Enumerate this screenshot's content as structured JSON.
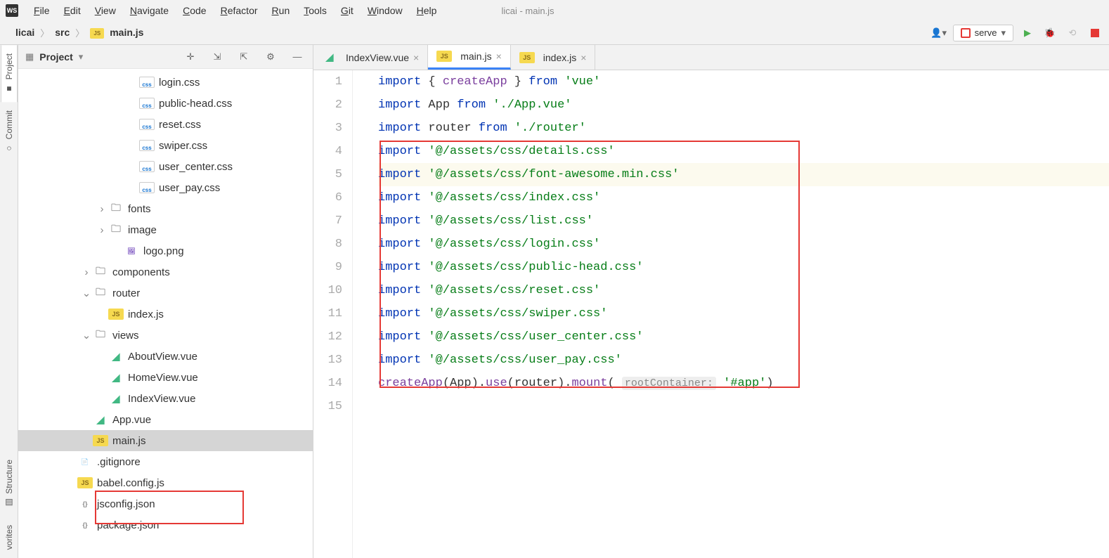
{
  "menubar": {
    "items": [
      "File",
      "Edit",
      "View",
      "Navigate",
      "Code",
      "Refactor",
      "Run",
      "Tools",
      "Git",
      "Window",
      "Help"
    ]
  },
  "window_title": "licai - main.js",
  "breadcrumbs": [
    "licai",
    "src",
    "main.js"
  ],
  "toolbar": {
    "run_config": "serve"
  },
  "left_rail": [
    "Project",
    "Commit",
    "Structure",
    "vorites"
  ],
  "project_label": "Project",
  "tree": [
    {
      "indent": 7,
      "type": "css",
      "name": "login.css"
    },
    {
      "indent": 7,
      "type": "css",
      "name": "public-head.css"
    },
    {
      "indent": 7,
      "type": "css",
      "name": "reset.css"
    },
    {
      "indent": 7,
      "type": "css",
      "name": "swiper.css"
    },
    {
      "indent": 7,
      "type": "css",
      "name": "user_center.css"
    },
    {
      "indent": 7,
      "type": "css",
      "name": "user_pay.css"
    },
    {
      "indent": 5,
      "chev": ">",
      "type": "folder",
      "name": "fonts"
    },
    {
      "indent": 5,
      "chev": ">",
      "type": "folder",
      "name": "image"
    },
    {
      "indent": 6,
      "type": "img",
      "name": "logo.png"
    },
    {
      "indent": 4,
      "chev": ">",
      "type": "folder",
      "name": "components"
    },
    {
      "indent": 4,
      "chev": "v",
      "type": "folder",
      "name": "router"
    },
    {
      "indent": 5,
      "type": "js",
      "name": "index.js"
    },
    {
      "indent": 4,
      "chev": "v",
      "type": "folder",
      "name": "views"
    },
    {
      "indent": 5,
      "type": "vue",
      "name": "AboutView.vue"
    },
    {
      "indent": 5,
      "type": "vue",
      "name": "HomeView.vue"
    },
    {
      "indent": 5,
      "type": "vue",
      "name": "IndexView.vue"
    },
    {
      "indent": 4,
      "type": "vue",
      "name": "App.vue"
    },
    {
      "indent": 4,
      "type": "js",
      "name": "main.js",
      "selected": true
    },
    {
      "indent": 3,
      "type": "generic",
      "name": ".gitignore"
    },
    {
      "indent": 3,
      "type": "js",
      "name": "babel.config.js"
    },
    {
      "indent": 3,
      "type": "json",
      "name": "jsconfig.json"
    },
    {
      "indent": 3,
      "type": "json",
      "name": "package.json"
    }
  ],
  "tabs": [
    {
      "icon": "vue",
      "label": "IndexView.vue",
      "active": false
    },
    {
      "icon": "js",
      "label": "main.js",
      "active": true
    },
    {
      "icon": "js",
      "label": "index.js",
      "active": false
    }
  ],
  "code": {
    "lines": [
      {
        "n": 1,
        "tokens": [
          [
            "kw",
            "import"
          ],
          [
            "",
            " { "
          ],
          [
            "fn",
            "createApp"
          ],
          [
            "",
            " } "
          ],
          [
            "kw",
            "from"
          ],
          [
            "",
            " "
          ],
          [
            "str",
            "'vue'"
          ]
        ]
      },
      {
        "n": 2,
        "tokens": [
          [
            "kw",
            "import"
          ],
          [
            "",
            " App "
          ],
          [
            "kw",
            "from"
          ],
          [
            "",
            " "
          ],
          [
            "str",
            "'./App.vue'"
          ]
        ]
      },
      {
        "n": 3,
        "tokens": [
          [
            "kw",
            "import"
          ],
          [
            "",
            " router "
          ],
          [
            "kw",
            "from"
          ],
          [
            "",
            " "
          ],
          [
            "str",
            "'./router'"
          ]
        ]
      },
      {
        "n": 4,
        "tokens": [
          [
            "kw",
            "import"
          ],
          [
            "",
            " "
          ],
          [
            "str",
            "'@/assets/css/details.css'"
          ]
        ]
      },
      {
        "n": 5,
        "cur": true,
        "tokens": [
          [
            "kw",
            "import"
          ],
          [
            "",
            " "
          ],
          [
            "str",
            "'@/assets/css/font-awesome.min.css'"
          ]
        ]
      },
      {
        "n": 6,
        "tokens": [
          [
            "kw",
            "import"
          ],
          [
            "",
            " "
          ],
          [
            "str",
            "'@/assets/css/index.css'"
          ]
        ]
      },
      {
        "n": 7,
        "tokens": [
          [
            "kw",
            "import"
          ],
          [
            "",
            " "
          ],
          [
            "str",
            "'@/assets/css/list.css'"
          ]
        ]
      },
      {
        "n": 8,
        "tokens": [
          [
            "kw",
            "import"
          ],
          [
            "",
            " "
          ],
          [
            "str",
            "'@/assets/css/login.css'"
          ]
        ]
      },
      {
        "n": 9,
        "tokens": [
          [
            "kw",
            "import"
          ],
          [
            "",
            " "
          ],
          [
            "str",
            "'@/assets/css/public-head.css'"
          ]
        ]
      },
      {
        "n": 10,
        "tokens": [
          [
            "kw",
            "import"
          ],
          [
            "",
            " "
          ],
          [
            "str",
            "'@/assets/css/reset.css'"
          ]
        ]
      },
      {
        "n": 11,
        "tokens": [
          [
            "kw",
            "import"
          ],
          [
            "",
            " "
          ],
          [
            "str",
            "'@/assets/css/swiper.css'"
          ]
        ]
      },
      {
        "n": 12,
        "tokens": [
          [
            "kw",
            "import"
          ],
          [
            "",
            " "
          ],
          [
            "str",
            "'@/assets/css/user_center.css'"
          ]
        ]
      },
      {
        "n": 13,
        "tokens": [
          [
            "kw",
            "import"
          ],
          [
            "",
            " "
          ],
          [
            "str",
            "'@/assets/css/user_pay.css'"
          ]
        ]
      },
      {
        "n": 14,
        "tokens": [
          [
            "fn",
            "createApp"
          ],
          [
            "",
            "(App)."
          ],
          [
            "fn",
            "use"
          ],
          [
            "",
            "(router)."
          ],
          [
            "fn",
            "mount"
          ],
          [
            "",
            "( "
          ],
          [
            "hint",
            "rootContainer:"
          ],
          [
            "",
            " "
          ],
          [
            "str",
            "'#app'"
          ],
          [
            "",
            ")"
          ]
        ]
      },
      {
        "n": 15,
        "tokens": [
          [
            "",
            ""
          ]
        ]
      }
    ]
  }
}
